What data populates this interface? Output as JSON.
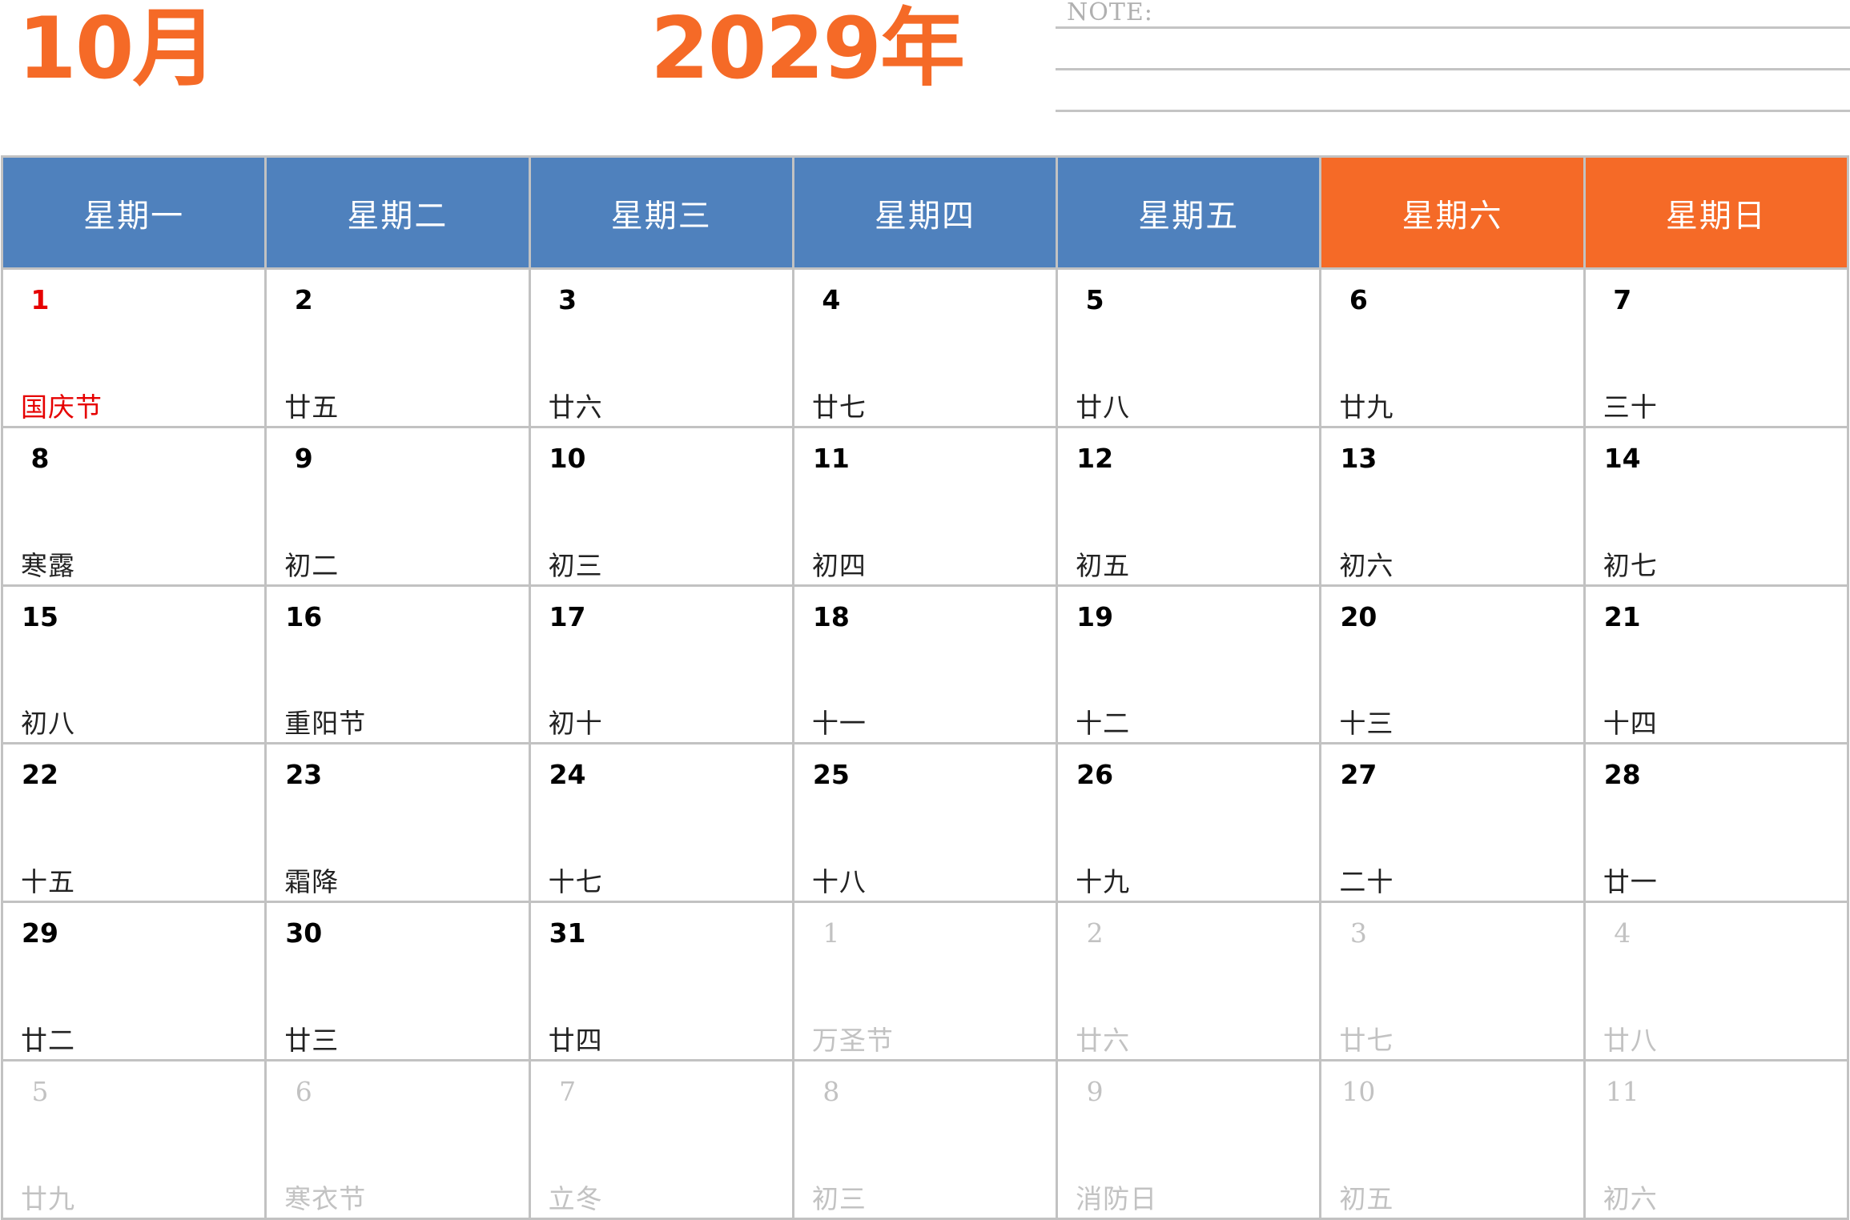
{
  "header": {
    "month": "10月",
    "year": "2029年",
    "note_label": "NOTE:"
  },
  "colors": {
    "accent_orange": "#f56a27",
    "weekday_blue": "#4f81bd",
    "holiday_red": "#e60000",
    "muted_gray": "#c2c2c2"
  },
  "weekdays": [
    {
      "label": "星期一",
      "weekend": false
    },
    {
      "label": "星期二",
      "weekend": false
    },
    {
      "label": "星期三",
      "weekend": false
    },
    {
      "label": "星期四",
      "weekend": false
    },
    {
      "label": "星期五",
      "weekend": false
    },
    {
      "label": "星期六",
      "weekend": true
    },
    {
      "label": "星期日",
      "weekend": true
    }
  ],
  "weeks": [
    [
      {
        "day": "1",
        "lunar": "国庆节",
        "holiday": true
      },
      {
        "day": "2",
        "lunar": "廿五"
      },
      {
        "day": "3",
        "lunar": "廿六"
      },
      {
        "day": "4",
        "lunar": "廿七"
      },
      {
        "day": "5",
        "lunar": "廿八"
      },
      {
        "day": "6",
        "lunar": "廿九"
      },
      {
        "day": "7",
        "lunar": "三十"
      }
    ],
    [
      {
        "day": "8",
        "lunar": "寒露"
      },
      {
        "day": "9",
        "lunar": "初二"
      },
      {
        "day": "10",
        "lunar": "初三"
      },
      {
        "day": "11",
        "lunar": "初四"
      },
      {
        "day": "12",
        "lunar": "初五"
      },
      {
        "day": "13",
        "lunar": "初六"
      },
      {
        "day": "14",
        "lunar": "初七"
      }
    ],
    [
      {
        "day": "15",
        "lunar": "初八"
      },
      {
        "day": "16",
        "lunar": "重阳节"
      },
      {
        "day": "17",
        "lunar": "初十"
      },
      {
        "day": "18",
        "lunar": "十一"
      },
      {
        "day": "19",
        "lunar": "十二"
      },
      {
        "day": "20",
        "lunar": "十三"
      },
      {
        "day": "21",
        "lunar": "十四"
      }
    ],
    [
      {
        "day": "22",
        "lunar": "十五"
      },
      {
        "day": "23",
        "lunar": "霜降"
      },
      {
        "day": "24",
        "lunar": "十七"
      },
      {
        "day": "25",
        "lunar": "十八"
      },
      {
        "day": "26",
        "lunar": "十九"
      },
      {
        "day": "27",
        "lunar": "二十"
      },
      {
        "day": "28",
        "lunar": "廿一"
      }
    ],
    [
      {
        "day": "29",
        "lunar": "廿二"
      },
      {
        "day": "30",
        "lunar": "廿三"
      },
      {
        "day": "31",
        "lunar": "廿四"
      },
      {
        "day": "1",
        "lunar": "万圣节",
        "other": true
      },
      {
        "day": "2",
        "lunar": "廿六",
        "other": true
      },
      {
        "day": "3",
        "lunar": "廿七",
        "other": true
      },
      {
        "day": "4",
        "lunar": "廿八",
        "other": true
      }
    ],
    [
      {
        "day": "5",
        "lunar": "廿九",
        "other": true
      },
      {
        "day": "6",
        "lunar": "寒衣节",
        "other": true
      },
      {
        "day": "7",
        "lunar": "立冬",
        "other": true
      },
      {
        "day": "8",
        "lunar": "初三",
        "other": true
      },
      {
        "day": "9",
        "lunar": "消防日",
        "other": true
      },
      {
        "day": "10",
        "lunar": "初五",
        "other": true
      },
      {
        "day": "11",
        "lunar": "初六",
        "other": true
      }
    ]
  ]
}
